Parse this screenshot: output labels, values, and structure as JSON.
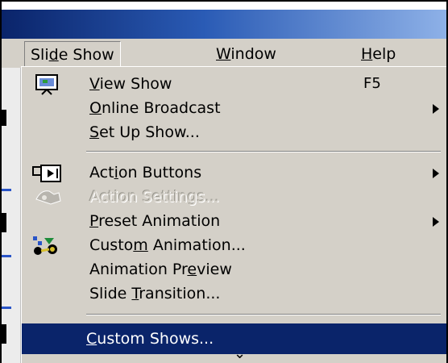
{
  "menubar": {
    "items": [
      {
        "label_pre": "Sli",
        "label_key": "d",
        "label_post": "e Show"
      },
      {
        "label_pre": "",
        "label_key": "W",
        "label_post": "indow"
      },
      {
        "label_pre": "",
        "label_key": "H",
        "label_post": "elp"
      }
    ]
  },
  "dropdown": {
    "items": [
      {
        "pre": "",
        "key": "V",
        "post": "iew Show",
        "shortcut": "F5",
        "icon": "view-show-icon"
      },
      {
        "pre": "",
        "key": "O",
        "post": "nline Broadcast",
        "submenu": true
      },
      {
        "pre": "",
        "key": "S",
        "post": "et Up Show..."
      },
      {
        "pre": "Act",
        "key": "i",
        "post": "on Buttons",
        "submenu": true,
        "icon": "action-buttons-icon"
      },
      {
        "pre": "",
        "key": "A",
        "post": "ction Settings...",
        "disabled": true,
        "icon": "action-settings-icon"
      },
      {
        "pre": "",
        "key": "P",
        "post": "reset Animation",
        "submenu": true
      },
      {
        "pre": "Custo",
        "key": "m",
        "post": " Animation...",
        "icon": "custom-animation-icon"
      },
      {
        "pre": "Animation Pr",
        "key": "e",
        "post": "view"
      },
      {
        "pre": "Slide ",
        "key": "T",
        "post": "ransition..."
      },
      {
        "pre": "",
        "key": "C",
        "post": "ustom Shows...",
        "highlighted": true
      }
    ],
    "expand": "⌄"
  },
  "colors": {
    "menu_bg": "#d4d0c8",
    "highlight": "#0a246a",
    "title_start": "#0a246a",
    "title_end": "#8fb2e8"
  }
}
